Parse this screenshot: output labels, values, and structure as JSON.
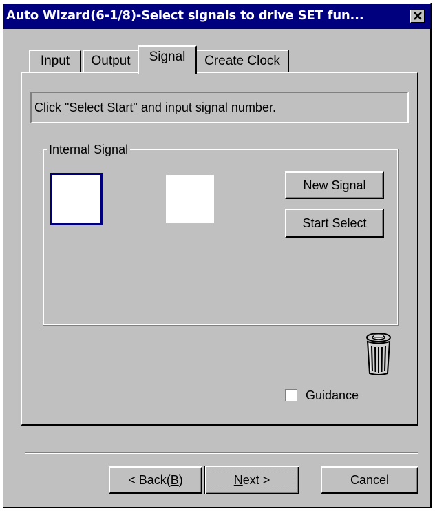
{
  "window": {
    "title": "Auto Wizard(6-1/8)-Select signals to drive SET fun..."
  },
  "tabs": [
    {
      "label": "Input",
      "active": false
    },
    {
      "label": "Output",
      "active": false
    },
    {
      "label": "Signal",
      "active": true
    },
    {
      "label": "Create Clock",
      "active": false
    }
  ],
  "signal_tab": {
    "instruction": "Click \"Select Start\" and input signal number.",
    "group_label": "Internal Signal",
    "new_signal_label": "New Signal",
    "start_select_label": "Start Select",
    "guidance_label": "Guidance",
    "guidance_checked": false
  },
  "footer": {
    "back_label": "< Back(",
    "back_mnemonic": "B",
    "back_suffix": ")",
    "next_mnemonic": "N",
    "next_label": "ext >",
    "cancel_label": "Cancel"
  },
  "colors": {
    "titlebar": "#00007f",
    "face": "#c0c0c0",
    "selected_slot_border": "#00007f"
  },
  "icons": {
    "close": "close-icon",
    "trash": "trash-can-icon"
  }
}
